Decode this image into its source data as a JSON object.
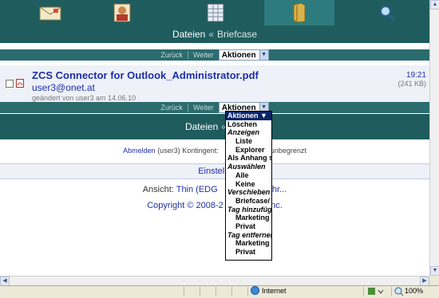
{
  "nav_tabs": [
    {
      "icon": "mail-icon",
      "label": "Mail"
    },
    {
      "icon": "contacts-icon",
      "label": "Contacts"
    },
    {
      "icon": "calendar-icon",
      "label": "Calendar"
    },
    {
      "icon": "briefcase-icon",
      "label": "Briefcase",
      "active": true
    },
    {
      "icon": "search-icon",
      "label": "Search"
    }
  ],
  "header": {
    "current": "Dateien",
    "separator": "«",
    "parent": "Briefcase"
  },
  "toolbar": {
    "back": "Zurück",
    "forward": "Weiter",
    "actions_label": "Aktionen"
  },
  "item": {
    "filename": "ZCS Connector for Outlook_Administrator.pdf",
    "sender": "user3@onet.at",
    "modified": "geändert von user3 am 14.06.10",
    "time": "19:21",
    "size": "(241 KB)"
  },
  "header2": {
    "current": "Dateien",
    "separator": "«",
    "partial": "B"
  },
  "footer": {
    "logout": "Abmelden",
    "user": "(user3)",
    "quota_label": "Kontingent:",
    "quota_value": "unbegrenzt",
    "settings": "Einstellu",
    "view_label": "Ansicht:",
    "view_value": "Thin (EDG",
    "view_tail": "ehr...",
    "copyright": "Copyright © 2008-2",
    "copyright_tail": ", Inc."
  },
  "dropdown": [
    {
      "label": "Aktionen ▼",
      "kind": "selected"
    },
    {
      "label": "Löschen",
      "kind": "normal"
    },
    {
      "label": "Anzeigen",
      "kind": "group"
    },
    {
      "label": "Liste",
      "kind": "indent"
    },
    {
      "label": "Explorer",
      "kind": "indent"
    },
    {
      "label": "Als Anhang s",
      "kind": "normal"
    },
    {
      "label": "Auswählen",
      "kind": "group"
    },
    {
      "label": "Alle",
      "kind": "indent"
    },
    {
      "label": "Keine",
      "kind": "indent"
    },
    {
      "label": "Verschieben",
      "kind": "group"
    },
    {
      "label": "Briefcase/",
      "kind": "indent"
    },
    {
      "label": "Tag hinzufüg",
      "kind": "group"
    },
    {
      "label": "Marketing",
      "kind": "indent"
    },
    {
      "label": "Privat",
      "kind": "indent"
    },
    {
      "label": "Tag entferner",
      "kind": "group"
    },
    {
      "label": "Marketing",
      "kind": "indent"
    },
    {
      "label": "Privat",
      "kind": "indent"
    }
  ],
  "status": {
    "zone": "Internet",
    "zoom": "100%"
  },
  "colors": {
    "header_bg": "#1f5c5e",
    "link": "#1c2faa",
    "selected": "#0a246a"
  }
}
